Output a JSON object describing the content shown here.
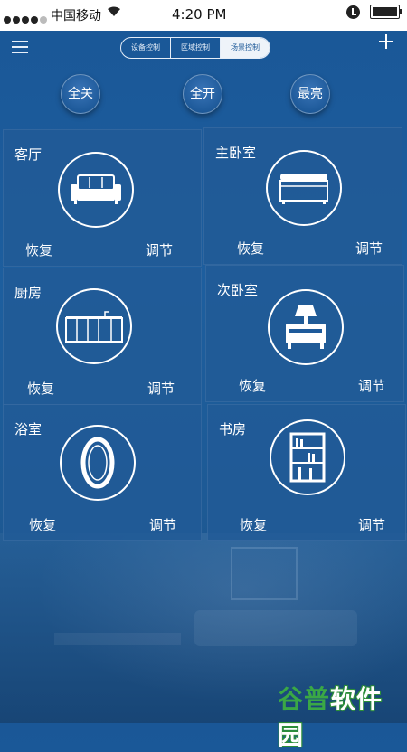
{
  "status_bar": {
    "carrier": "中国移动",
    "time": "4:20 PM"
  },
  "nav": {
    "tabs": [
      {
        "label": "设备控制",
        "active": false
      },
      {
        "label": "区域控制",
        "active": false
      },
      {
        "label": "场景控制",
        "active": true
      }
    ]
  },
  "quick_actions": {
    "all_off": "全关",
    "all_on": "全开",
    "brightest": "最亮"
  },
  "rooms": [
    {
      "name": "客厅",
      "icon": "sofa-icon",
      "restore": "恢复",
      "adjust": "调节"
    },
    {
      "name": "主卧室",
      "icon": "bed-icon",
      "restore": "恢复",
      "adjust": "调节"
    },
    {
      "name": "厨房",
      "icon": "kitchen-cabinet-icon",
      "restore": "恢复",
      "adjust": "调节"
    },
    {
      "name": "次卧室",
      "icon": "nightstand-lamp-icon",
      "restore": "恢复",
      "adjust": "调节"
    },
    {
      "name": "浴室",
      "icon": "mirror-icon",
      "restore": "恢复",
      "adjust": "调节"
    },
    {
      "name": "书房",
      "icon": "bookshelf-icon",
      "restore": "恢复",
      "adjust": "调节"
    }
  ],
  "watermark": {
    "part1": "谷普",
    "part2": "软件园"
  },
  "colors": {
    "background": "#1d5e9e",
    "card": "#215a96",
    "accent_white": "#ffffff"
  }
}
